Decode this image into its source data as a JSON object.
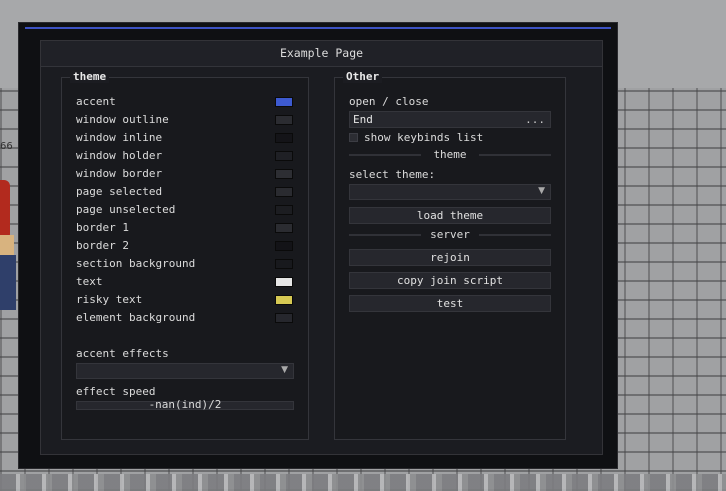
{
  "side_text": "66",
  "window": {
    "page_title": "Example Page"
  },
  "theme_section": {
    "title": "theme",
    "items": [
      {
        "label": "accent",
        "color": "#3d5ad0"
      },
      {
        "label": "window outline",
        "color": "#2b2c31"
      },
      {
        "label": "window inline",
        "color": "#141418"
      },
      {
        "label": "window holder",
        "color": "#1f2025"
      },
      {
        "label": "window border",
        "color": "#2d2e33"
      },
      {
        "label": "page selected",
        "color": "#2a2b30"
      },
      {
        "label": "page unselected",
        "color": "#1c1d21"
      },
      {
        "label": "border 1",
        "color": "#2b2c31"
      },
      {
        "label": "border 2",
        "color": "#131317"
      },
      {
        "label": "section background",
        "color": "#18191d"
      },
      {
        "label": "text",
        "color": "#e6e6e6"
      },
      {
        "label": "risky text",
        "color": "#d6c953"
      },
      {
        "label": "element background",
        "color": "#26272d"
      }
    ],
    "accent_effects_label": "accent effects",
    "accent_effects_value": "",
    "effect_speed_label": "effect speed",
    "effect_speed_value": "-nan(ind)/2"
  },
  "other_section": {
    "title": "Other",
    "open_close_label": "open / close",
    "keybind_value": "End",
    "keybind_dots": "...",
    "show_keybinds_label": "show keybinds list",
    "show_keybinds_checked": false,
    "theme_divider": "theme",
    "select_theme_label": "select theme:",
    "select_theme_value": "",
    "load_theme_button": "load theme",
    "server_divider": "server",
    "rejoin_button": "rejoin",
    "copy_join_button": "copy join script",
    "test_button": "test"
  }
}
